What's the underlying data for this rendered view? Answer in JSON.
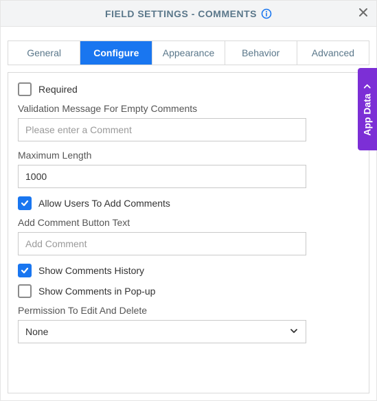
{
  "header": {
    "title": "FIELD SETTINGS - COMMENTS"
  },
  "tabs": {
    "general": "General",
    "configure": "Configure",
    "appearance": "Appearance",
    "behavior": "Behavior",
    "advanced": "Advanced"
  },
  "form": {
    "required_label": "Required",
    "validation_label": "Validation Message For Empty Comments",
    "validation_placeholder": "Please enter a Comment",
    "maxlen_label": "Maximum Length",
    "maxlen_value": "1000",
    "allow_add_label": "Allow Users To Add Comments",
    "button_text_label": "Add Comment Button Text",
    "button_text_placeholder": "Add Comment",
    "show_history_label": "Show Comments History",
    "show_popup_label": "Show Comments in Pop-up",
    "permission_label": "Permission To Edit And Delete",
    "permission_value": "None"
  },
  "side": {
    "label": "App Data"
  }
}
